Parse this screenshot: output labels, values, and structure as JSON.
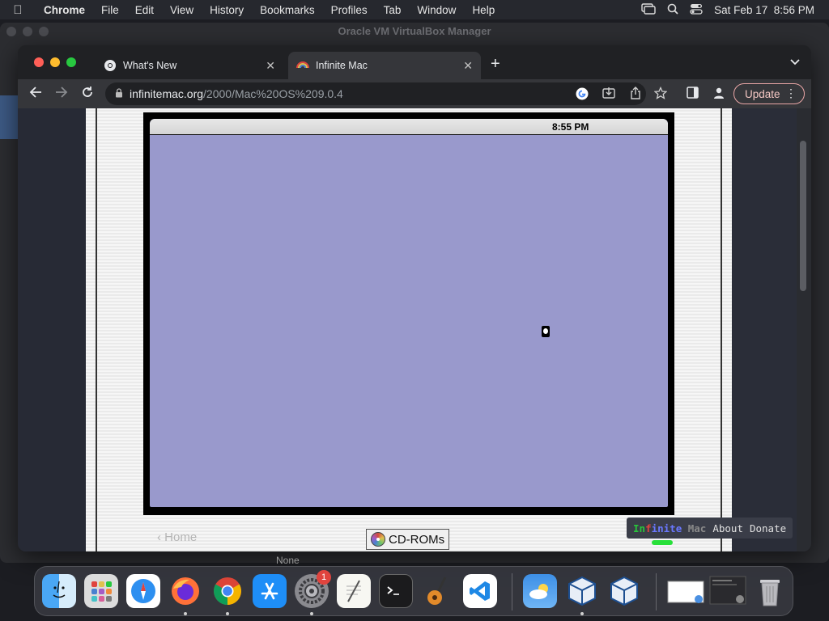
{
  "menubar": {
    "app": "Chrome",
    "items": [
      "File",
      "Edit",
      "View",
      "History",
      "Bookmarks",
      "Profiles",
      "Tab",
      "Window",
      "Help"
    ],
    "datetime": "Sat Feb 17  8:56 PM"
  },
  "vbox": {
    "title": "Oracle VM VirtualBox Manager"
  },
  "tabs": [
    {
      "title": "What's New"
    },
    {
      "title": "Infinite Mac"
    }
  ],
  "toolbar": {
    "url_host": "infinitemac.org",
    "url_path": "/2000/Mac%20OS%209.0.4",
    "update_label": "Update"
  },
  "emulator": {
    "clock": "8:55 PM",
    "home_link": "‹ Home",
    "cdrom_label": "CD-ROMs",
    "brand": [
      "In",
      "f",
      "inite",
      " Mac"
    ],
    "brand_colors": [
      "#28c43a",
      "#e0443e",
      "#6a78ff",
      "#8a8a8a"
    ],
    "about_label": "About",
    "donate_label": "Donate",
    "screen_color": "#9999cc"
  },
  "below_chrome_text": "None",
  "dock": {
    "apps": [
      "Finder",
      "Launchpad",
      "Safari",
      "Firefox",
      "Chrome",
      "App Store",
      "System Settings",
      "TextEdit",
      "Terminal",
      "GarageBand",
      "Visual Studio Code",
      "Weather",
      "VirtualBox",
      "VirtualBox VM",
      "Preview",
      "Screenshot",
      "Trash"
    ],
    "settings_badge": "1"
  }
}
